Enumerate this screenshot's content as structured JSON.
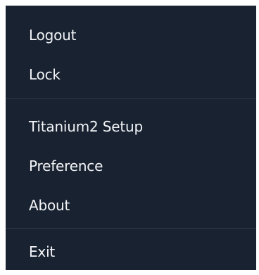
{
  "menu": {
    "items": [
      {
        "label": "Logout"
      },
      {
        "label": "Lock"
      },
      {
        "label": "Titanium2 Setup"
      },
      {
        "label": "Preference"
      },
      {
        "label": "About"
      },
      {
        "label": "Exit"
      }
    ]
  }
}
